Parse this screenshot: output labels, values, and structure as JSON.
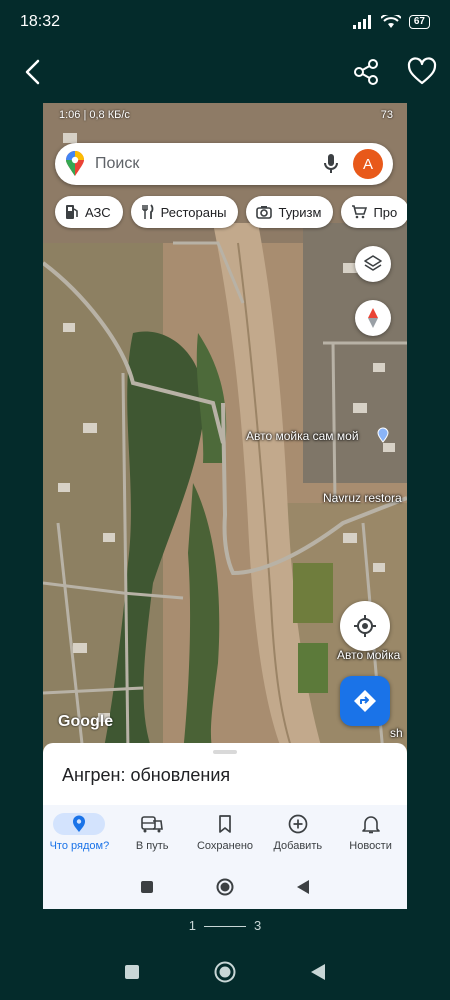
{
  "outer_status": {
    "time": "18:32",
    "battery": "67"
  },
  "inner_status": {
    "left": "1:06 | 0,8 КБ/с",
    "battery": "73"
  },
  "search": {
    "placeholder": "Поиск",
    "avatar_letter": "А"
  },
  "chips": [
    {
      "label": "АЗС",
      "icon": "gas-station-icon"
    },
    {
      "label": "Рестораны",
      "icon": "restaurant-icon"
    },
    {
      "label": "Туризм",
      "icon": "camera-icon"
    },
    {
      "label": "Про",
      "icon": "cart-icon"
    }
  ],
  "map_labels": {
    "car_wash_1": "Авто мойка сам мой",
    "restaurant": "Navruz restora",
    "car_wash_2": "Авто мойка",
    "corner_a": "sh",
    "logo": "Google"
  },
  "sheet": {
    "title": "Ангрен: обновления"
  },
  "nav": [
    {
      "label": "Что рядом?",
      "icon": "location-pin-icon",
      "active": true
    },
    {
      "label": "В путь",
      "icon": "commute-icon",
      "active": false
    },
    {
      "label": "Сохранено",
      "icon": "bookmark-icon",
      "active": false
    },
    {
      "label": "Добавить",
      "icon": "add-circle-icon",
      "active": false
    },
    {
      "label": "Новости",
      "icon": "bell-icon",
      "active": false
    }
  ],
  "pager": {
    "current": "1",
    "total": "3"
  },
  "colors": {
    "accent": "#1a73e8",
    "avatar": "#e8591a",
    "background": "#042b2b"
  }
}
